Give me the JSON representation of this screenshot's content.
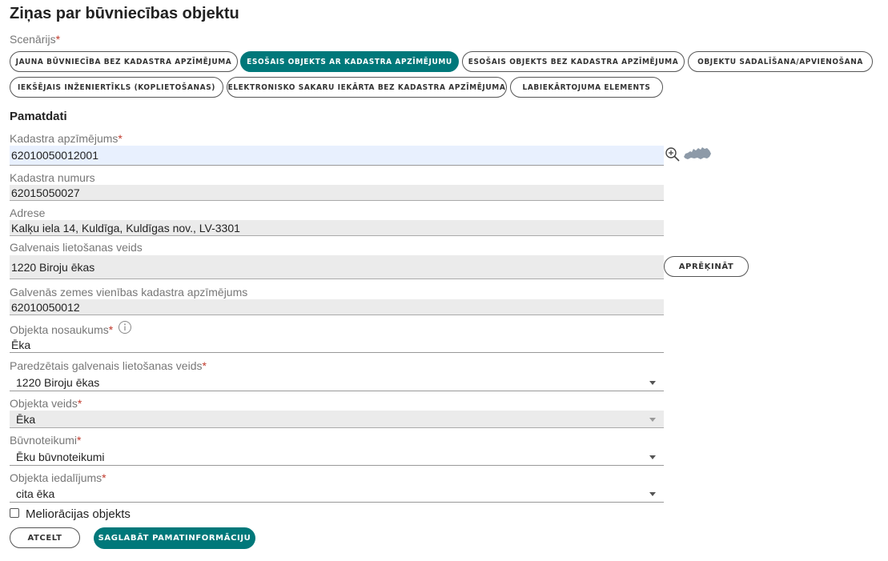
{
  "page": {
    "title": "Ziņas par būvniecības objektu"
  },
  "scenario": {
    "label": "Scenārijs",
    "required_mark": "*",
    "options": [
      "JAUNA BŪVNIECĪBA BEZ KADASTRA APZĪMĒJUMA",
      "ESOŠAIS OBJEKTS AR KADASTRA APZĪMĒJUMU",
      "ESOŠAIS OBJEKTS BEZ KADASTRA APZĪMĒJUMA",
      "OBJEKTU SADALĪŠANA/APVIENOŠANA",
      "IEKŠĒJAIS INŽENIERTĪKLS (KOPLIETOŠANAS)",
      "ELEKTRONISKO SAKARU IEKĀRTA BEZ KADASTRA APZĪMĒJUMA",
      "LABIEKĀRTOJUMA ELEMENTS"
    ],
    "selected": "ESOŠAIS OBJEKTS AR KADASTRA APZĪMĒJUMU"
  },
  "section": {
    "title": "Pamatdati"
  },
  "fields": {
    "kadastra_apzimejums": {
      "label": "Kadastra apzīmējums",
      "value": "62010050012001"
    },
    "kadastra_numurs": {
      "label": "Kadastra numurs",
      "value": "62015050027"
    },
    "adrese": {
      "label": "Adrese",
      "value": "Kalķu iela 14, Kuldīga, Kuldīgas nov., LV-3301"
    },
    "galvenais_lietosanas_veids": {
      "label": "Galvenais lietošanas veids",
      "value": "1220 Biroju ēkas"
    },
    "zemes_vienibas_apzimejums": {
      "label": "Galvenās zemes vienības kadastra apzīmējums",
      "value": "62010050012"
    },
    "objekta_nosaukums": {
      "label": "Objekta nosaukums",
      "value": "Ēka"
    },
    "paredzetais_veids": {
      "label": "Paredzētais galvenais lietošanas veids",
      "value": "1220 Biroju ēkas"
    },
    "objekta_veids": {
      "label": "Objekta veids",
      "value": "Ēka"
    },
    "buvnoteikumi": {
      "label": "Būvnoteikumi",
      "value": "Ēku būvnoteikumi"
    },
    "objekta_iedalijums": {
      "label": "Objekta iedalījums",
      "value": "cita ēka"
    }
  },
  "required_mark": "*",
  "checkbox": {
    "label": "Meliorācijas objekts",
    "checked": false
  },
  "buttons": {
    "aprekinat": "APRĒĶINĀT",
    "atcelt": "ATCELT",
    "saglabat": "SAGLABĀT PAMATINFORMĀCIJU"
  },
  "colors": {
    "accent": "#00787a",
    "required": "#c0392b",
    "readonly_bg": "#ebebeb",
    "focus_bg": "#e8f0fe"
  },
  "icons": {
    "search": "zoom-in-icon",
    "map": "latvia-map-icon",
    "info": "info-icon",
    "dropdown": "chevron-down-icon"
  }
}
